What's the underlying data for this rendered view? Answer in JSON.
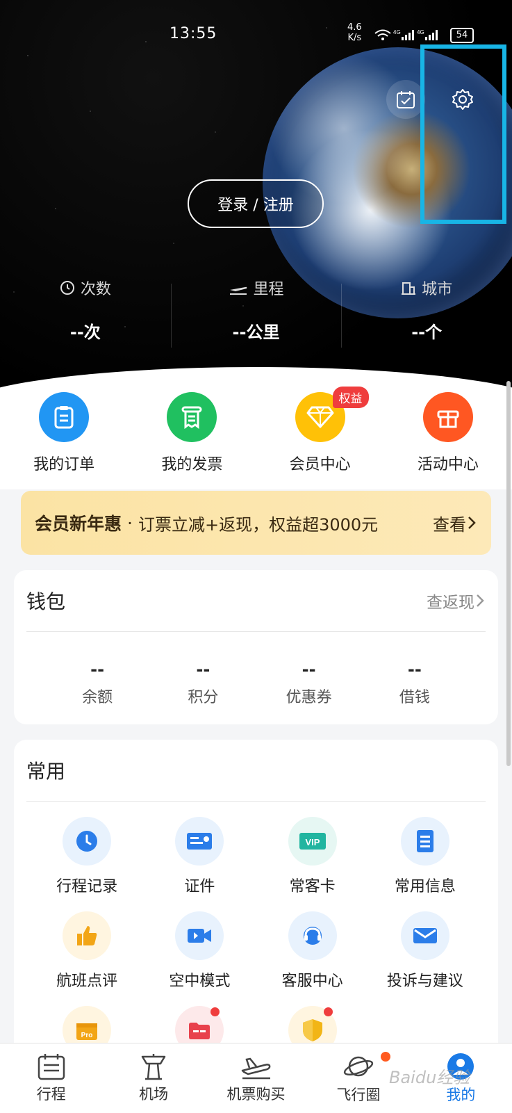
{
  "status_bar": {
    "time": "13:55",
    "net_speed_value": "4.6",
    "net_speed_unit": "K/s",
    "signal": "4G 4G",
    "battery": "54"
  },
  "hero": {
    "login_label": "登录 / 注册",
    "stats": [
      {
        "label": "次数",
        "icon": "clock-icon",
        "value": "--次"
      },
      {
        "label": "里程",
        "icon": "plane-icon",
        "value": "--公里"
      },
      {
        "label": "城市",
        "icon": "building-icon",
        "value": "--个"
      }
    ]
  },
  "top_icons": {
    "calendar": "calendar-check-icon",
    "settings": "gear-icon"
  },
  "quick_actions": [
    {
      "label": "我的订单",
      "color": "#2196f3",
      "icon": "clipboard-icon"
    },
    {
      "label": "我的发票",
      "color": "#20c060",
      "icon": "receipt-icon"
    },
    {
      "label": "会员中心",
      "color": "#ffc107",
      "icon": "diamond-icon",
      "badge": "权益"
    },
    {
      "label": "活动中心",
      "color": "#ff5722",
      "icon": "gift-icon"
    }
  ],
  "promo": {
    "title": "会员新年惠",
    "separator": "·",
    "text": "订票立减+返现，权益超3000元",
    "more": "查看"
  },
  "wallet": {
    "title": "钱包",
    "link": "查返现",
    "items": [
      {
        "value": "--",
        "label": "余额"
      },
      {
        "value": "--",
        "label": "积分"
      },
      {
        "value": "--",
        "label": "优惠券"
      },
      {
        "value": "--",
        "label": "借钱"
      }
    ]
  },
  "common": {
    "title": "常用",
    "items": [
      {
        "label": "行程记录",
        "icon": "clock-icon",
        "bg": "#e8f2fd",
        "fg": "#2b7de9"
      },
      {
        "label": "证件",
        "icon": "id-card-icon",
        "bg": "#e8f2fd",
        "fg": "#2b7de9"
      },
      {
        "label": "常客卡",
        "icon": "vip-card-icon",
        "bg": "#e6f7f3",
        "fg": "#21b5a0"
      },
      {
        "label": "常用信息",
        "icon": "document-icon",
        "bg": "#e8f2fd",
        "fg": "#2b7de9"
      },
      {
        "label": "航班点评",
        "icon": "thumbs-up-icon",
        "bg": "#fff5e0",
        "fg": "#f2a516"
      },
      {
        "label": "空中模式",
        "icon": "video-camera-icon",
        "bg": "#e8f2fd",
        "fg": "#2b7de9"
      },
      {
        "label": "客服中心",
        "icon": "headset-icon",
        "bg": "#e8f2fd",
        "fg": "#2b7de9"
      },
      {
        "label": "投诉与建议",
        "icon": "mail-icon",
        "bg": "#e8f2fd",
        "fg": "#2b7de9"
      },
      {
        "label": "",
        "icon": "pro-box-icon",
        "bg": "#fff5e0",
        "fg": "#f2a516"
      },
      {
        "label": "",
        "icon": "folder-icon",
        "bg": "#fde9ea",
        "fg": "#e8414c",
        "dot": true
      },
      {
        "label": "",
        "icon": "shield-icon",
        "bg": "#fff5e0",
        "fg": "#f2b516",
        "dot": true
      }
    ]
  },
  "tabbar": [
    {
      "label": "行程",
      "icon": "itinerary-icon"
    },
    {
      "label": "机场",
      "icon": "airport-tower-icon"
    },
    {
      "label": "机票购买",
      "icon": "plane-takeoff-icon"
    },
    {
      "label": "飞行圈",
      "icon": "planet-icon",
      "dot": true
    },
    {
      "label": "我的",
      "icon": "profile-icon",
      "active": true
    }
  ],
  "watermark": "Baidu经验",
  "colors": {
    "accent": "#1a7ae6",
    "highlight_box": "#18b5e6",
    "badge_red": "#ef3d3d"
  }
}
